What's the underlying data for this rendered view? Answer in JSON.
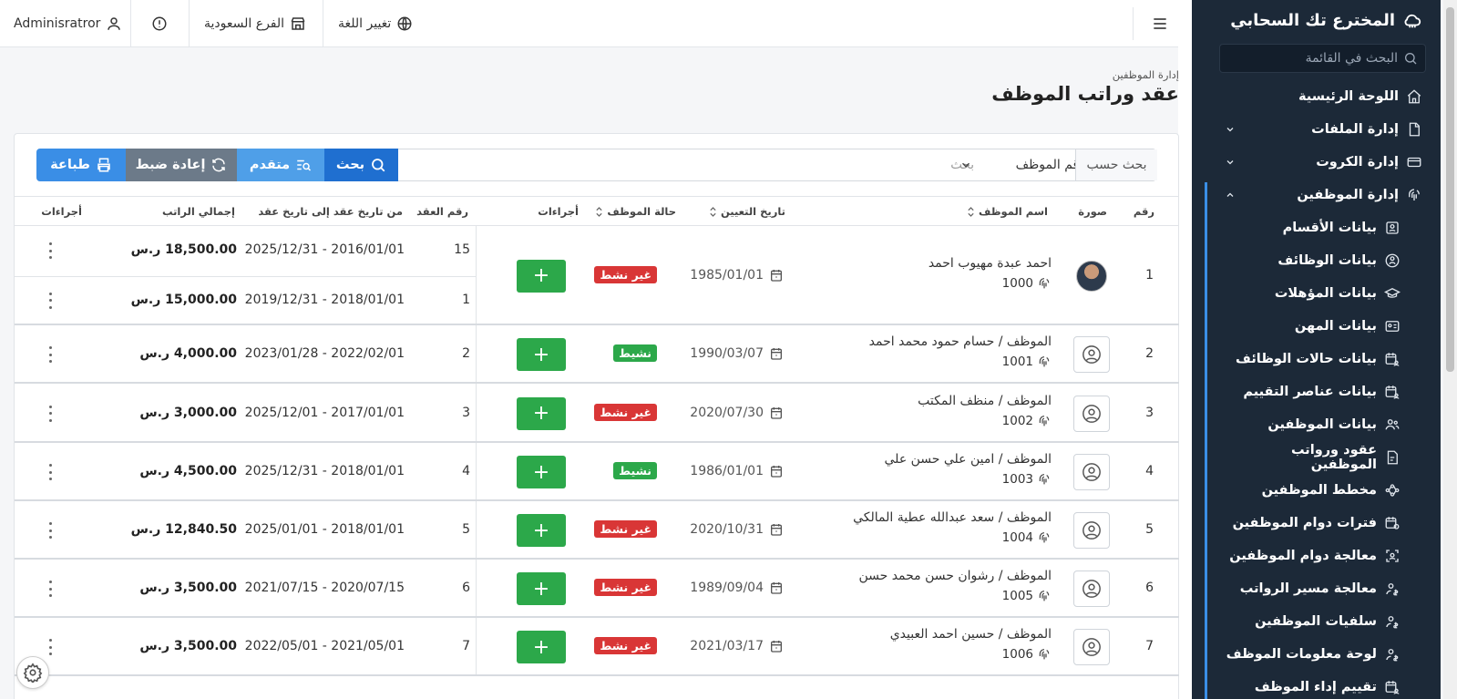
{
  "sidebar": {
    "app_title": "المخترع تك السحابي",
    "search_placeholder": "البحث في القائمة",
    "items": [
      {
        "label": "اللوحة الرئيسية",
        "icon": "home-icon",
        "sub": false
      },
      {
        "label": "إدارة الملفات",
        "icon": "file-icon",
        "sub": false,
        "chevron": "down"
      },
      {
        "label": "إدارة الكروت",
        "icon": "card-icon",
        "sub": false,
        "chevron": "down"
      },
      {
        "label": "إدارة الموظفين",
        "icon": "fingerprint-icon",
        "sub": false,
        "chevron": "up"
      },
      {
        "label": "بيانات الأقسام",
        "icon": "department-icon",
        "sub": true
      },
      {
        "label": "بيانات الوظائف",
        "icon": "job-icon",
        "sub": true
      },
      {
        "label": "بيانات المؤهلات",
        "icon": "graduation-icon",
        "sub": true
      },
      {
        "label": "بيانات المهن",
        "icon": "id-card-icon",
        "sub": true
      },
      {
        "label": "بيانات حالات الوظائف",
        "icon": "calendar-user-icon",
        "sub": true
      },
      {
        "label": "بيانات عناصر التقييم",
        "icon": "calendar-user-icon",
        "sub": true
      },
      {
        "label": "بيانات الموظفين",
        "icon": "users-icon",
        "sub": true
      },
      {
        "label": "عقود ورواتب الموظفين",
        "icon": "contract-icon",
        "sub": true
      },
      {
        "label": "مخطط الموظفين",
        "icon": "chart-icon",
        "sub": true
      },
      {
        "label": "فترات دوام الموظفين",
        "icon": "calendar-clock-icon",
        "sub": true
      },
      {
        "label": "معالجة دوام الموظفين",
        "icon": "scan-face-icon",
        "sub": true
      },
      {
        "label": "معالجة مسير الرواتب",
        "icon": "user-money-icon",
        "sub": true
      },
      {
        "label": "سلفيات الموظفين",
        "icon": "user-money-icon",
        "sub": true
      },
      {
        "label": "لوحة معلومات الموظف",
        "icon": "user-money-icon",
        "sub": true
      },
      {
        "label": "تقييم إداء الموظف",
        "icon": "calendar-user-icon",
        "sub": true
      }
    ]
  },
  "topbar": {
    "user": "Adminisratror",
    "branch": "الفرع السعودية",
    "language": "تغيير اللغة"
  },
  "page": {
    "breadcrumb": "إدارة الموظفين",
    "title": "عقد وراتب الموظف"
  },
  "searchbar": {
    "search_by_label": "بحث حسب",
    "field_value": "رقم الموظف",
    "input_placeholder": "بحث",
    "search_btn": "بحث",
    "advanced_btn": "متقدم",
    "reset_btn": "إعادة ضبط",
    "print_btn": "طباعة"
  },
  "table": {
    "headers": {
      "num": "رقم",
      "photo": "صورة",
      "name": "اسم الموظف",
      "hire_date": "تاريخ التعيين",
      "status": "حالة الموظف",
      "actions": "أجراءات",
      "contract_num": "رقم العقد",
      "range": "من تاريخ عقد إلى تاريخ عقد",
      "total": "إجمالي الراتب",
      "actions2": "أجراءات"
    },
    "rows": [
      {
        "num": "1",
        "name": "احمد عبدة مهيوب احمد",
        "id": "1000",
        "hire": "1985/01/01",
        "status": "غير نشط",
        "active": false,
        "photo": true,
        "contracts": [
          {
            "num": "15",
            "range": "2025/12/31 - 2016/01/01",
            "total": "18,500.00 ر.س"
          },
          {
            "num": "1",
            "range": "2019/12/31 - 2018/01/01",
            "total": "15,000.00 ر.س"
          }
        ]
      },
      {
        "num": "2",
        "name": "الموظف / حسام حمود محمد احمد",
        "id": "1001",
        "hire": "1990/03/07",
        "status": "نشيط",
        "active": true,
        "contracts": [
          {
            "num": "2",
            "range": "2023/01/28 - 2022/02/01",
            "total": "4,000.00 ر.س"
          }
        ]
      },
      {
        "num": "3",
        "name": "الموظف / منظف المكتب",
        "id": "1002",
        "hire": "2020/07/30",
        "status": "غير نشط",
        "active": false,
        "contracts": [
          {
            "num": "3",
            "range": "2025/12/01 - 2017/01/01",
            "total": "3,000.00 ر.س"
          }
        ]
      },
      {
        "num": "4",
        "name": "الموظف / امين علي حسن علي",
        "id": "1003",
        "hire": "1986/01/01",
        "status": "نشيط",
        "active": true,
        "contracts": [
          {
            "num": "4",
            "range": "2025/12/31 - 2018/01/01",
            "total": "4,500.00 ر.س"
          }
        ]
      },
      {
        "num": "5",
        "name": "الموظف / سعد عبدالله عطية المالكي",
        "id": "1004",
        "hire": "2020/10/31",
        "status": "غير نشط",
        "active": false,
        "contracts": [
          {
            "num": "5",
            "range": "2025/01/01 - 2018/01/01",
            "total": "12,840.50 ر.س"
          }
        ]
      },
      {
        "num": "6",
        "name": "الموظف / رشوان حسن محمد حسن",
        "id": "1005",
        "hire": "1989/09/04",
        "status": "غير نشط",
        "active": false,
        "contracts": [
          {
            "num": "6",
            "range": "2021/07/15 - 2020/07/15",
            "total": "3,500.00 ر.س"
          }
        ]
      },
      {
        "num": "7",
        "name": "الموظف / حسين احمد العبيدي",
        "id": "1006",
        "hire": "2021/03/17",
        "status": "غير نشط",
        "active": false,
        "contracts": [
          {
            "num": "7",
            "range": "2022/05/01 - 2021/05/01",
            "total": "3,500.00 ر.س"
          }
        ]
      }
    ],
    "add_symbol": "+"
  },
  "colors": {
    "sidebar_bg": "#1c2938",
    "primary": "#1f6fd0",
    "active": "#2ca84a",
    "inactive": "#d93636"
  }
}
